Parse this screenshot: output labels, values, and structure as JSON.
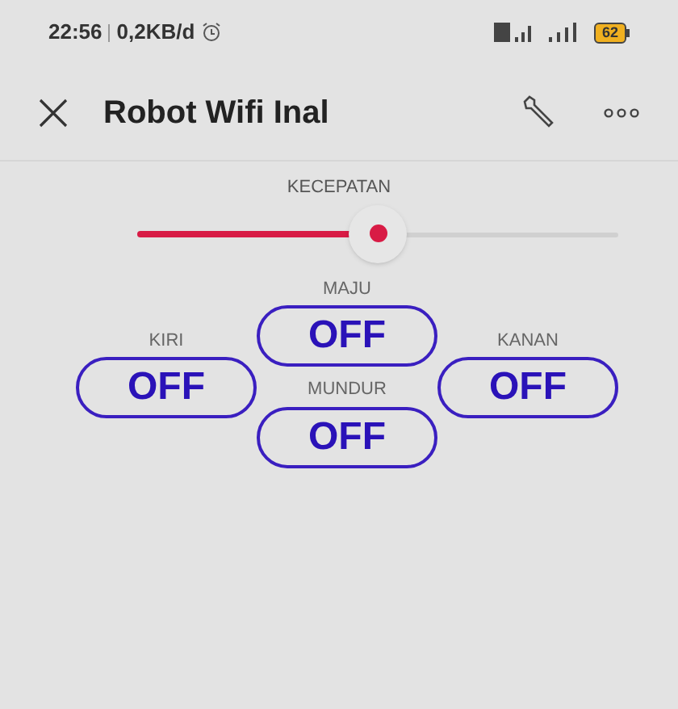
{
  "status_bar": {
    "time": "22:56",
    "data_rate": "0,2KB/d",
    "battery": "62"
  },
  "app_bar": {
    "title": "Robot Wifi Inal"
  },
  "speed": {
    "label": "KECEPATAN",
    "level": 0.5
  },
  "controls": {
    "left": {
      "label": "KIRI",
      "value": "OFF",
      "on": false
    },
    "center": [
      {
        "label": "MAJU",
        "value": "OFF",
        "on": false
      },
      {
        "label": "MUNDUR",
        "value": "OFF",
        "on": false
      }
    ],
    "right": {
      "label": "KANAN",
      "value": "OFF",
      "on": false
    }
  }
}
